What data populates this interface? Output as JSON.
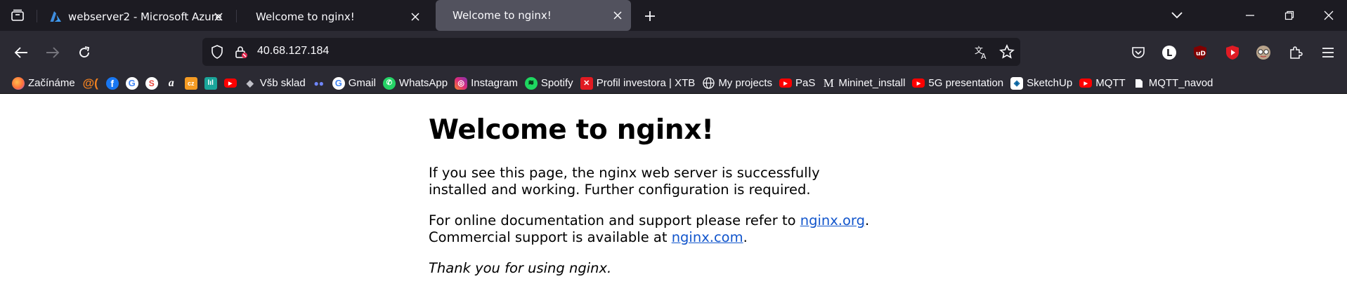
{
  "browser": {
    "tabs": [
      {
        "title": "webserver2 - Microsoft Azure",
        "active": false
      },
      {
        "title": "Welcome to nginx!",
        "active": false
      },
      {
        "title": "Welcome to nginx!",
        "active": true
      }
    ],
    "url": "40.68.127.184",
    "accent": "#1c1b22",
    "toolbar_color": "#2b2a33",
    "active_tab_color": "#52525e"
  },
  "bookmarks": [
    {
      "label": "Začínáme",
      "icon": "firefox-icon",
      "color": "#ff7139"
    },
    {
      "label": "",
      "icon": "at-icon",
      "color": "#f5821f"
    },
    {
      "label": "",
      "icon": "facebook-icon",
      "color": "#1877f2"
    },
    {
      "label": "",
      "icon": "google-icon",
      "color": "#ffffff"
    },
    {
      "label": "",
      "icon": "s-icon",
      "color": "#e8453c"
    },
    {
      "label": "",
      "icon": "amazon-icon",
      "color": "#2b2a33"
    },
    {
      "label": "",
      "icon": "orange-box-icon",
      "color": "#f59b23"
    },
    {
      "label": "",
      "icon": "teal-bars-icon",
      "color": "#1aa59a"
    },
    {
      "label": "",
      "icon": "youtube-icon",
      "color": "#ff0000"
    },
    {
      "label": "Všb sklad",
      "icon": "drive-icon",
      "color": "#c0c0c8"
    },
    {
      "label": "",
      "icon": "glasses-icon",
      "color": "#6f86ff"
    },
    {
      "label": "Gmail",
      "icon": "google-icon",
      "color": "#ffffff"
    },
    {
      "label": "WhatsApp",
      "icon": "whatsapp-icon",
      "color": "#25d366"
    },
    {
      "label": "Instagram",
      "icon": "instagram-icon",
      "color": "#d6249f"
    },
    {
      "label": "Spotify",
      "icon": "spotify-icon",
      "color": "#1ed760"
    },
    {
      "label": "Profil investora | XTB",
      "icon": "xtb-icon",
      "color": "#e11b22"
    },
    {
      "label": "My projects",
      "icon": "globe-icon",
      "color": "#2b2a33"
    },
    {
      "label": "PaS",
      "icon": "youtube-icon",
      "color": "#ff0000"
    },
    {
      "label": "Mininet_install",
      "icon": "m-icon",
      "color": "#2b2a33"
    },
    {
      "label": "5G presentation",
      "icon": "youtube-icon",
      "color": "#ff0000"
    },
    {
      "label": "SketchUp",
      "icon": "sketchup-icon",
      "color": "#005f9e"
    },
    {
      "label": "MQTT",
      "icon": "youtube-icon",
      "color": "#ff0000"
    },
    {
      "label": "MQTT_navod",
      "icon": "page-icon",
      "color": "#2b2a33"
    }
  ],
  "page": {
    "heading": "Welcome to nginx!",
    "p1": "If you see this page, the nginx web server is successfully installed and working. Further configuration is required.",
    "p2_pre": "For online documentation and support please refer to ",
    "p2_link": "nginx.org",
    "p2_mid": ".",
    "p2_pre2": "Commercial support is available at ",
    "p2_link2": "nginx.com",
    "p2_post": ".",
    "p3": "Thank you for using nginx."
  }
}
